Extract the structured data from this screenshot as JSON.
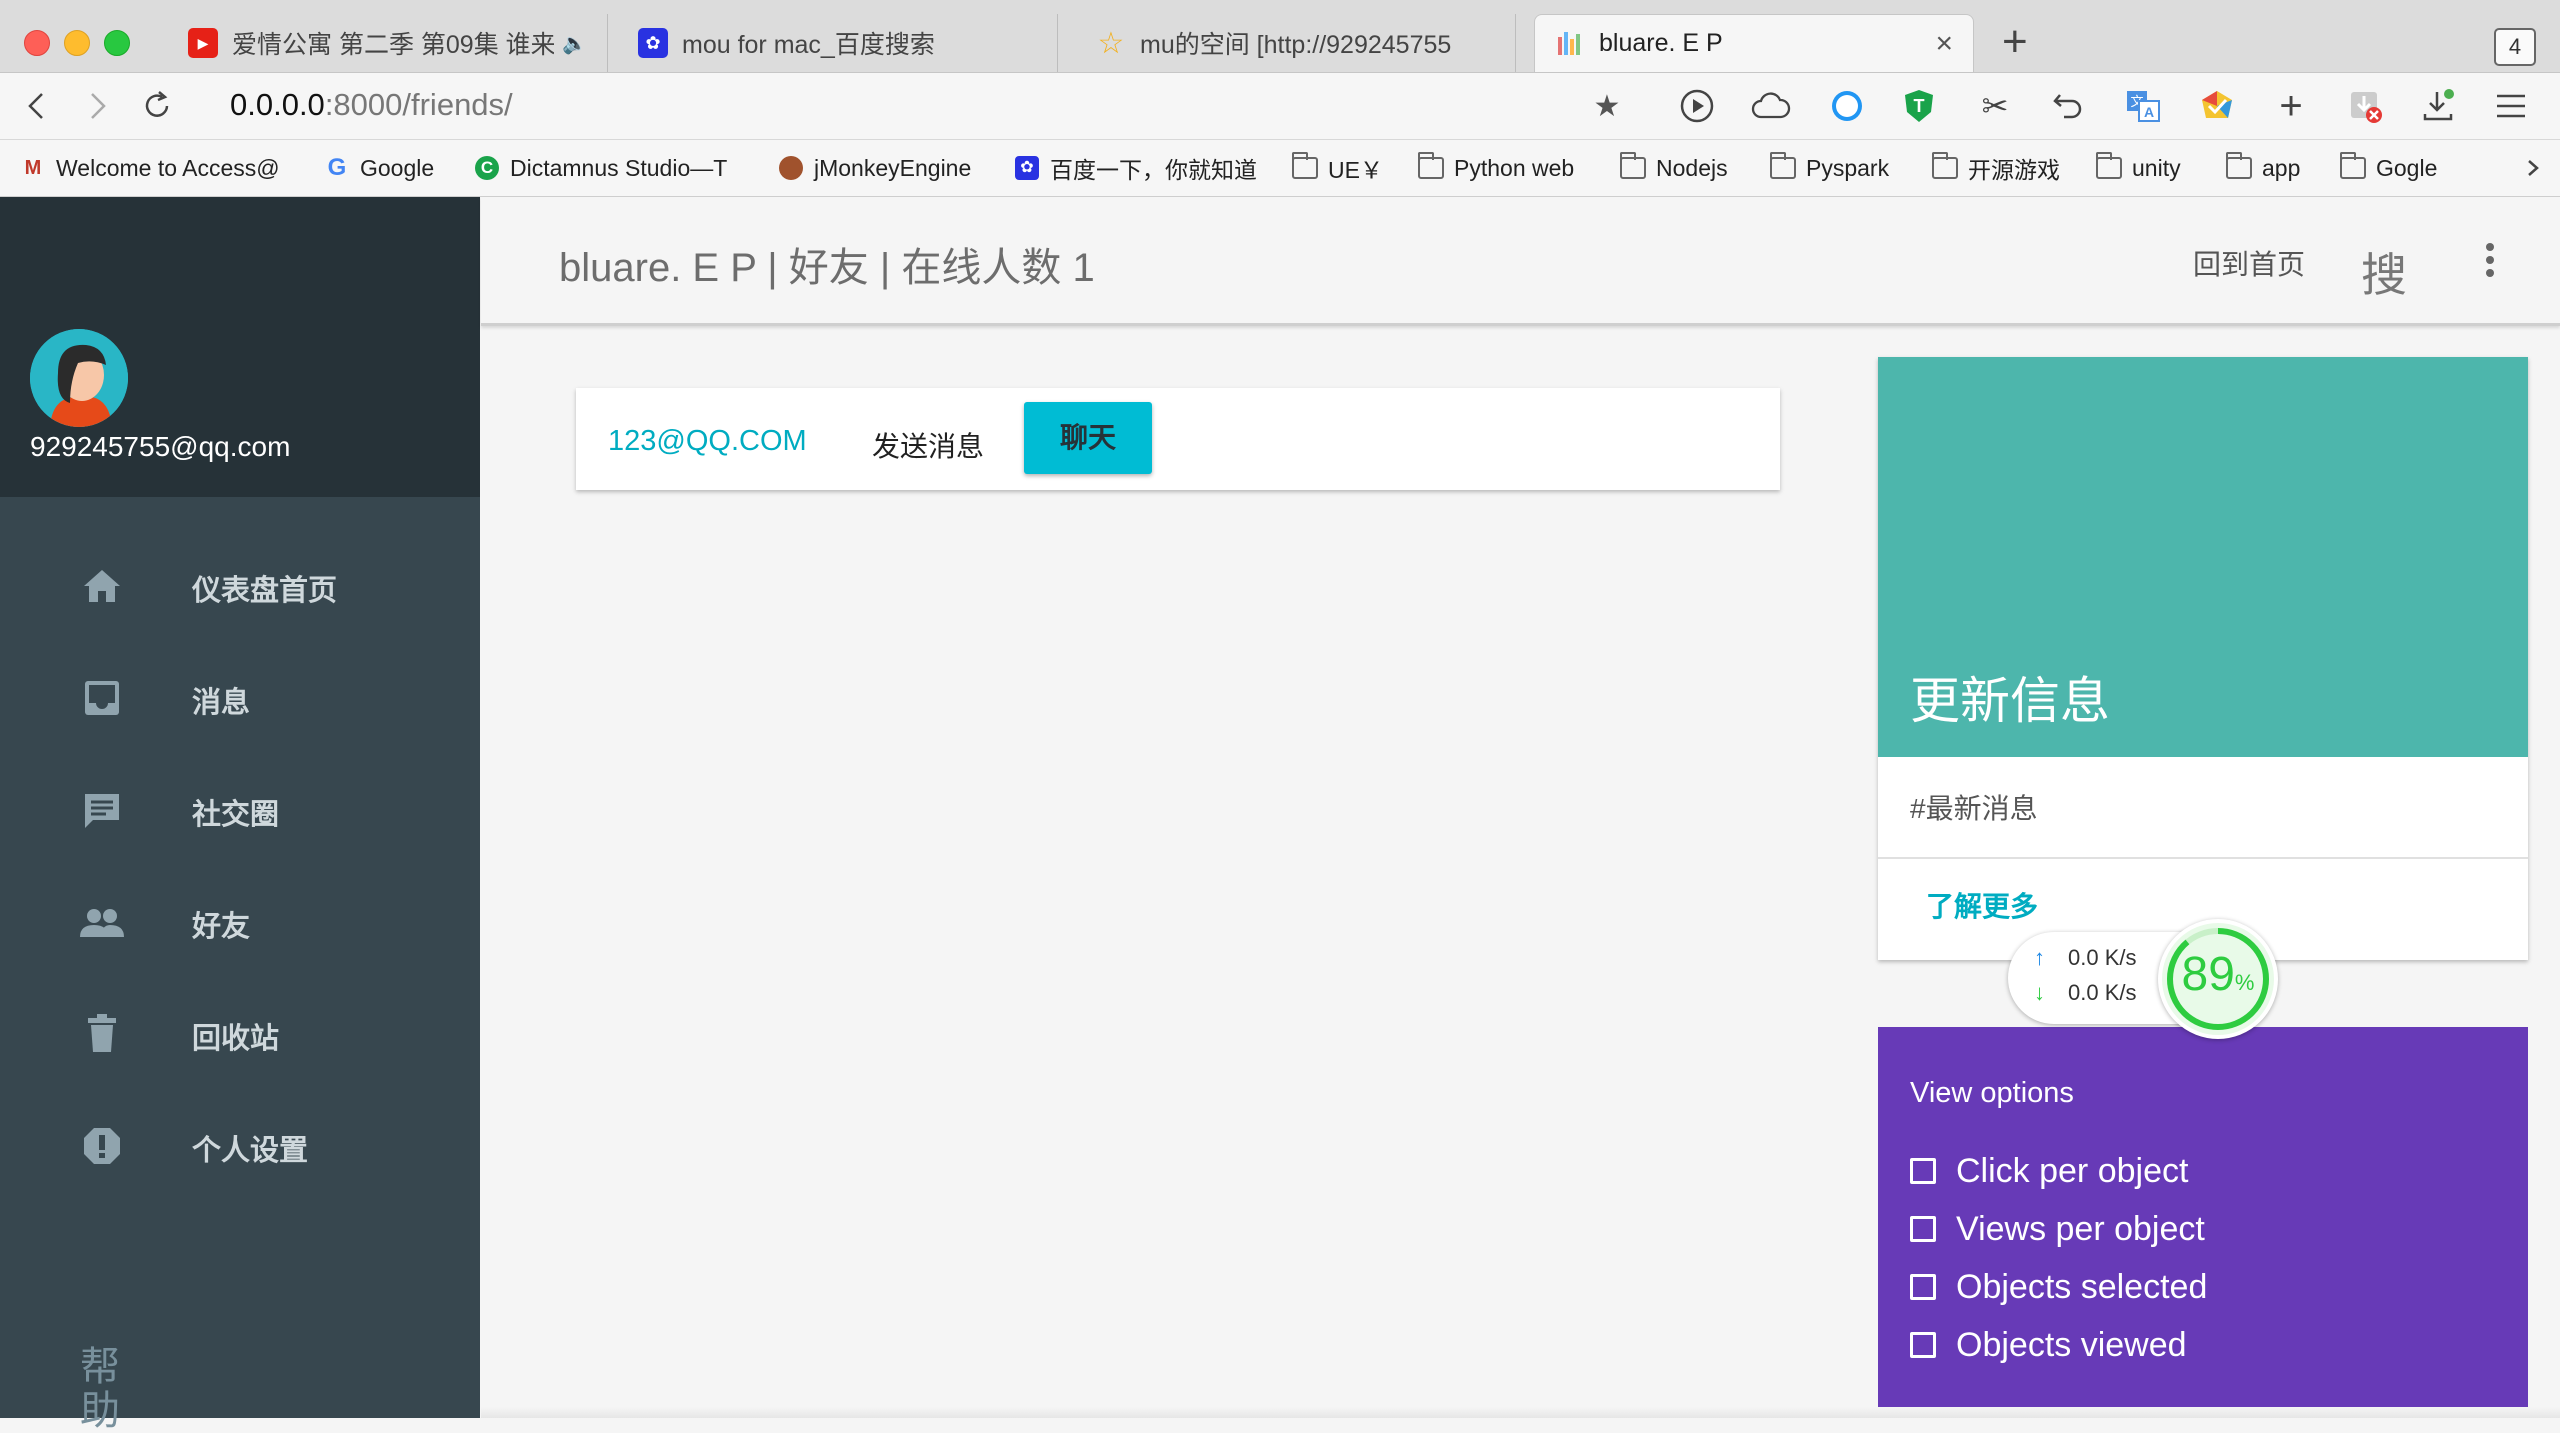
{
  "browser": {
    "tabs": [
      {
        "label": "爱情公寓 第二季 第09集 谁来",
        "icon": "youtube-icon",
        "active": false
      },
      {
        "label": "mou for mac_百度搜索",
        "icon": "baidu-paw-icon",
        "active": false
      },
      {
        "label": "mu的空间 [http://929245755",
        "icon": "star-icon",
        "active": false
      },
      {
        "label": "bluare. E P",
        "icon": "site-bars-icon",
        "active": true
      }
    ],
    "tab_count": "4",
    "url_host": "0.0.0.0",
    "url_path": ":8000/friends/",
    "bookmarks": [
      {
        "label": "Welcome to Access@",
        "icon": "access-icon"
      },
      {
        "label": "Google",
        "icon": "google-icon"
      },
      {
        "label": "Dictamnus Studio—T",
        "icon": "dictamnus-icon"
      },
      {
        "label": "jMonkeyEngine",
        "icon": "jmonkey-icon"
      },
      {
        "label": "百度一下，你就知道",
        "icon": "baidu-paw-icon"
      },
      {
        "label": "UE￥",
        "icon": "folder-icon"
      },
      {
        "label": "Python web",
        "icon": "folder-icon"
      },
      {
        "label": "Nodejs",
        "icon": "folder-icon"
      },
      {
        "label": "Pyspark",
        "icon": "folder-icon"
      },
      {
        "label": "开源游戏",
        "icon": "folder-icon"
      },
      {
        "label": "unity",
        "icon": "folder-icon"
      },
      {
        "label": "app",
        "icon": "folder-icon"
      },
      {
        "label": "Gogle",
        "icon": "folder-icon"
      }
    ]
  },
  "sidebar": {
    "user_email": "929245755@qq.com",
    "items": [
      {
        "label": "仪表盘首页",
        "icon": "home-icon"
      },
      {
        "label": "消息",
        "icon": "inbox-icon"
      },
      {
        "label": "社交圈",
        "icon": "chat-icon"
      },
      {
        "label": "好友",
        "icon": "people-icon"
      },
      {
        "label": "回收站",
        "icon": "trash-icon"
      },
      {
        "label": "个人设置",
        "icon": "alert-icon"
      }
    ],
    "help": "帮助"
  },
  "header": {
    "title": "bluare. E P | 好友 | 在线人数 1",
    "home_link": "回到首页",
    "search_label": "搜"
  },
  "friend": {
    "email": "123@QQ.COM",
    "send_label": "发送消息",
    "chat_button": "聊天"
  },
  "update_card": {
    "title": "更新信息",
    "latest": "#最新消息",
    "learn_more": "了解更多"
  },
  "speed_widget": {
    "upload": "0.0 K/s",
    "download": "0.0 K/s",
    "percent": "89",
    "percent_unit": "%"
  },
  "view_options": {
    "title": "View options",
    "options": [
      {
        "label": "Click per object",
        "checked": false
      },
      {
        "label": "Views per object",
        "checked": false
      },
      {
        "label": "Objects selected",
        "checked": false
      },
      {
        "label": "Objects viewed",
        "checked": false
      }
    ]
  },
  "colors": {
    "sidebar": "#37474f",
    "sidebar_header": "#263238",
    "accent": "#00bcd4",
    "update_head": "#4db6ac",
    "view_card": "#673ab7"
  }
}
